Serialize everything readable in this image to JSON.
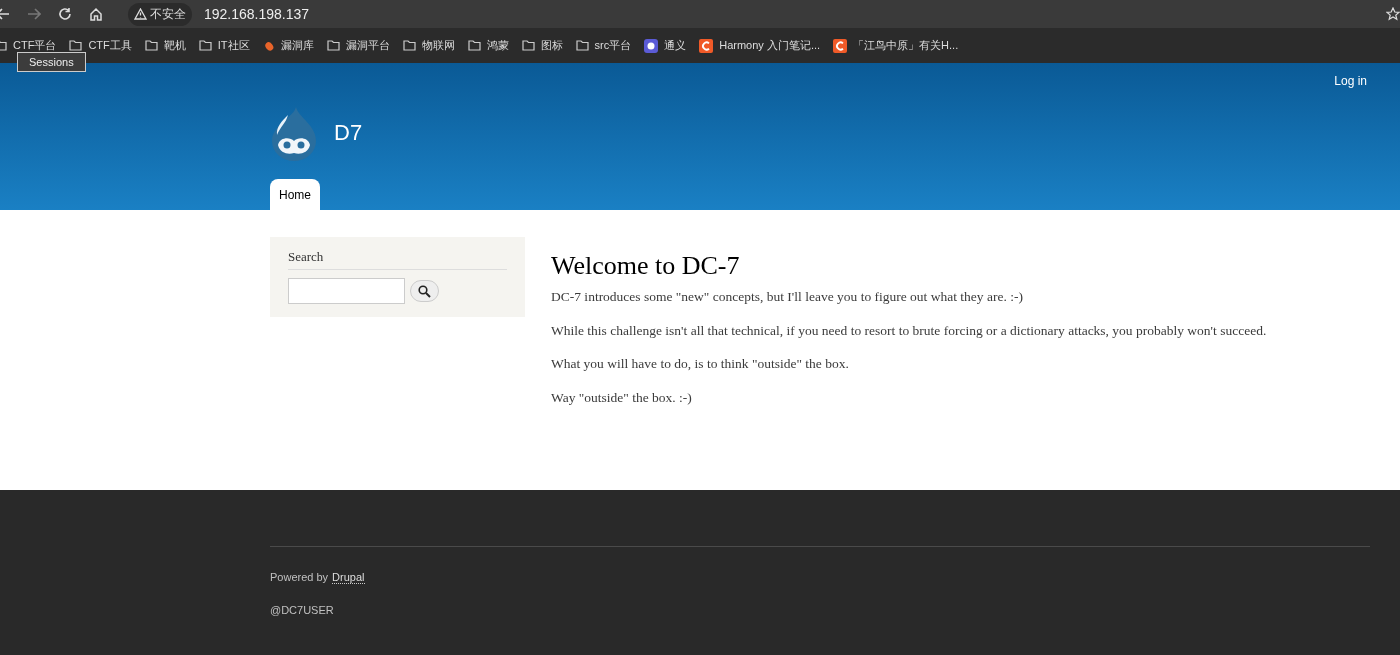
{
  "browser": {
    "security_label": "不安全",
    "url": "192.168.198.137",
    "bookmarks": [
      {
        "kind": "folder",
        "label": "CTF平台"
      },
      {
        "kind": "folder",
        "label": "CTF工具"
      },
      {
        "kind": "folder",
        "label": "靶机"
      },
      {
        "kind": "folder",
        "label": "IT社区"
      },
      {
        "kind": "bug",
        "label": "漏洞库"
      },
      {
        "kind": "folder",
        "label": "漏洞平台"
      },
      {
        "kind": "folder",
        "label": "物联网"
      },
      {
        "kind": "folder",
        "label": "鸿蒙"
      },
      {
        "kind": "folder",
        "label": "图标"
      },
      {
        "kind": "folder",
        "label": "src平台"
      },
      {
        "kind": "app",
        "label": "通义"
      },
      {
        "kind": "c",
        "label": "Harmony 入门笔记..."
      },
      {
        "kind": "c",
        "label": "「江鸟中原」有关H..."
      }
    ],
    "tooltip": "Sessions"
  },
  "header": {
    "login_link": "Log in",
    "site_name": "D7",
    "tabs": [
      {
        "label": "Home",
        "selected": true
      }
    ]
  },
  "sidebar": {
    "search_title": "Search"
  },
  "main": {
    "title": "Welcome to DC-7",
    "paragraphs": [
      "DC-7 introduces some \"new\" concepts, but I'll leave you to figure out what they are.  :-)",
      "While this challenge isn't all that technical, if you need to resort to brute forcing or a dictionary attacks, you probably won't succeed.",
      "What you will have to do, is to think \"outside\" the box.",
      "Way \"outside\" the box.  :-)"
    ]
  },
  "footer": {
    "powered_by": "Powered by",
    "link": "Drupal",
    "user": "@DC7USER"
  }
}
